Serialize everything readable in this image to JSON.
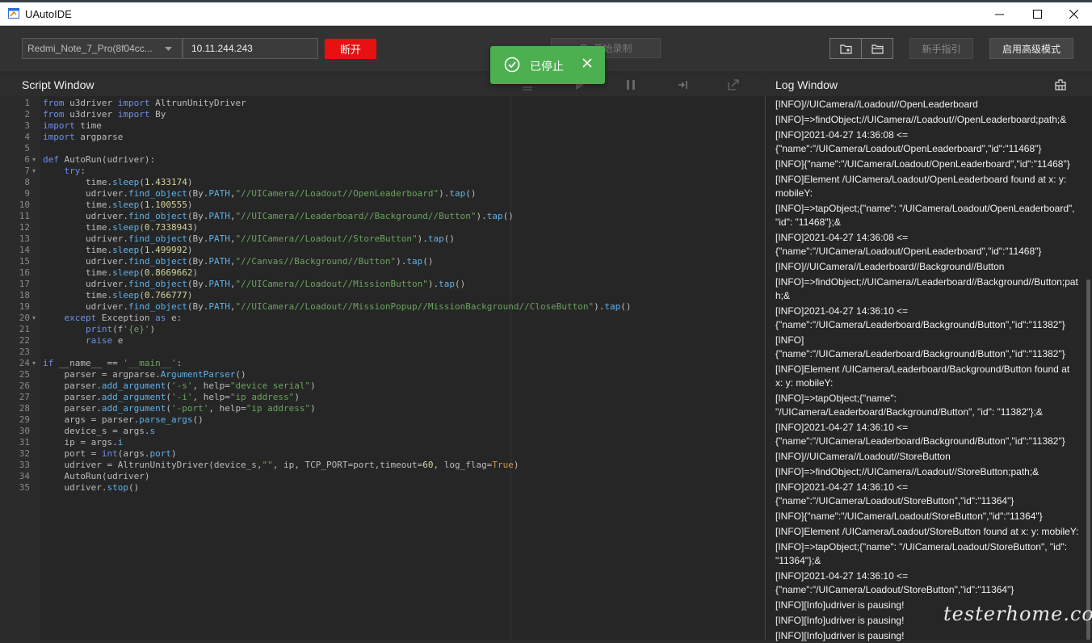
{
  "window": {
    "title": "UAutoIDE"
  },
  "toolbar": {
    "device": "Redmi_Note_7_Pro(8f04cc...",
    "ip": "10.11.244.243",
    "disconnect_label": "断开",
    "record_label": "开始录制",
    "guide_label": "新手指引",
    "advanced_label": "启用高级模式"
  },
  "toast": {
    "text": "已停止"
  },
  "script_panel": {
    "title": "Script Window"
  },
  "log_panel": {
    "title": "Log Window"
  },
  "code_lines": [
    "from u3driver import AltrunUnityDriver",
    "from u3driver import By",
    "import time",
    "import argparse",
    "",
    "def AutoRun(udriver):",
    "    try:",
    "        time.sleep(1.433174)",
    "        udriver.find_object(By.PATH,\"//UICamera//Loadout//OpenLeaderboard\").tap()",
    "        time.sleep(1.100555)",
    "        udriver.find_object(By.PATH,\"//UICamera//Leaderboard//Background//Button\").tap()",
    "        time.sleep(0.7338943)",
    "        udriver.find_object(By.PATH,\"//UICamera//Loadout//StoreButton\").tap()",
    "        time.sleep(1.499992)",
    "        udriver.find_object(By.PATH,\"//Canvas//Background//Button\").tap()",
    "        time.sleep(0.8669662)",
    "        udriver.find_object(By.PATH,\"//UICamera//Loadout//MissionButton\").tap()",
    "        time.sleep(0.766777)",
    "        udriver.find_object(By.PATH,\"//UICamera//Loadout//MissionPopup//MissionBackground//CloseButton\").tap()",
    "    except Exception as e:",
    "        print(f'{e}')",
    "        raise e",
    "",
    "if __name__ == '__main__':",
    "    parser = argparse.ArgumentParser()",
    "    parser.add_argument('-s', help=\"device serial\")",
    "    parser.add_argument('-i', help=\"ip address\")",
    "    parser.add_argument('-port', help=\"ip address\")",
    "    args = parser.parse_args()",
    "    device_s = args.s",
    "    ip = args.i",
    "    port = int(args.port)",
    "    udriver = AltrunUnityDriver(device_s,\"\", ip, TCP_PORT=port,timeout=60, log_flag=True)",
    "    AutoRun(udriver)",
    "    udriver.stop()"
  ],
  "log_entries": [
    "[INFO]//UICamera//Loadout//OpenLeaderboard",
    "[INFO]=>findObject;//UICamera//Loadout//OpenLeaderboard;path;&",
    "[INFO]2021-04-27 14:36:08 <= {\"name\":\"/UICamera/Loadout/OpenLeaderboard\",\"id\":\"11468\"}",
    "[INFO]{\"name\":\"/UICamera/Loadout/OpenLeaderboard\",\"id\":\"11468\"}",
    "[INFO]Element /UICamera/Loadout/OpenLeaderboard found at x: y: mobileY:",
    "[INFO]=>tapObject;{\"name\": \"/UICamera/Loadout/OpenLeaderboard\", \"id\": \"11468\"};&",
    "[INFO]2021-04-27 14:36:08 <= {\"name\":\"/UICamera/Loadout/OpenLeaderboard\",\"id\":\"11468\"}",
    "[INFO]//UICamera//Leaderboard//Background//Button",
    "[INFO]=>findObject;//UICamera//Leaderboard//Background//Button;path;&",
    "[INFO]2021-04-27 14:36:10 <= {\"name\":\"/UICamera/Leaderboard/Background/Button\",\"id\":\"11382\"}",
    "[INFO] {\"name\":\"/UICamera/Leaderboard/Background/Button\",\"id\":\"11382\"}",
    "[INFO]Element /UICamera/Leaderboard/Background/Button found at x: y: mobileY:",
    "[INFO]=>tapObject;{\"name\": \"/UICamera/Leaderboard/Background/Button\", \"id\": \"11382\"};&",
    "[INFO]2021-04-27 14:36:10 <= {\"name\":\"/UICamera/Leaderboard/Background/Button\",\"id\":\"11382\"}",
    "[INFO]//UICamera//Loadout//StoreButton",
    "[INFO]=>findObject;//UICamera//Loadout//StoreButton;path;&",
    "[INFO]2021-04-27 14:36:10 <= {\"name\":\"/UICamera/Loadout/StoreButton\",\"id\":\"11364\"}",
    "[INFO]{\"name\":\"/UICamera/Loadout/StoreButton\",\"id\":\"11364\"}",
    "[INFO]Element /UICamera/Loadout/StoreButton found at x: y: mobileY:",
    "[INFO]=>tapObject;{\"name\": \"/UICamera/Loadout/StoreButton\", \"id\": \"11364\"};&",
    "[INFO]2021-04-27 14:36:10 <= {\"name\":\"/UICamera/Loadout/StoreButton\",\"id\":\"11364\"}",
    "[INFO][Info]udriver is pausing!",
    "[INFO][Info]udriver is pausing!",
    "[INFO][Info]udriver is pausing!"
  ],
  "watermark": "testerhome.com"
}
